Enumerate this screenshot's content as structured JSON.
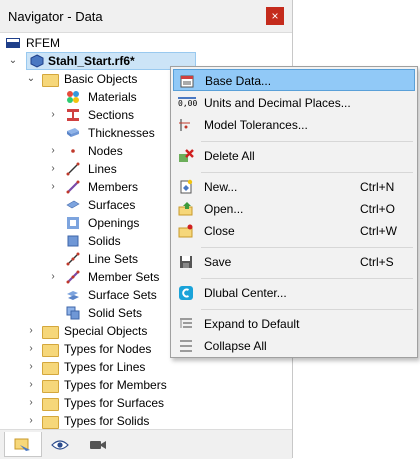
{
  "window": {
    "title": "Navigator - Data",
    "close_glyph": "×"
  },
  "tree": {
    "root": "RFEM",
    "file": "Stahl_Start.rf6*",
    "basic_objects": "Basic Objects",
    "items": [
      {
        "label": "Materials",
        "icon": "materials-icon"
      },
      {
        "label": "Sections",
        "icon": "sections-icon"
      },
      {
        "label": "Thicknesses",
        "icon": "thicknesses-icon"
      },
      {
        "label": "Nodes",
        "icon": "nodes-icon"
      },
      {
        "label": "Lines",
        "icon": "lines-icon"
      },
      {
        "label": "Members",
        "icon": "members-icon"
      },
      {
        "label": "Surfaces",
        "icon": "surfaces-icon"
      },
      {
        "label": "Openings",
        "icon": "openings-icon"
      },
      {
        "label": "Solids",
        "icon": "solids-icon"
      },
      {
        "label": "Line Sets",
        "icon": "line-sets-icon"
      },
      {
        "label": "Member Sets",
        "icon": "member-sets-icon"
      },
      {
        "label": "Surface Sets",
        "icon": "surface-sets-icon"
      },
      {
        "label": "Solid Sets",
        "icon": "solid-sets-icon"
      }
    ],
    "groups": [
      "Special Objects",
      "Types for Nodes",
      "Types for Lines",
      "Types for Members",
      "Types for Surfaces",
      "Types for Solids"
    ]
  },
  "menu": {
    "items": [
      {
        "label": "Base Data...",
        "shortcut": "",
        "icon": "base-data-icon"
      },
      {
        "label": "Units and Decimal Places...",
        "shortcut": "",
        "icon": "units-icon"
      },
      {
        "label": "Model Tolerances...",
        "shortcut": "",
        "icon": "tolerances-icon"
      },
      {
        "label": "Delete All",
        "shortcut": "",
        "icon": "delete-all-icon"
      },
      {
        "label": "New...",
        "shortcut": "Ctrl+N",
        "icon": "new-icon"
      },
      {
        "label": "Open...",
        "shortcut": "Ctrl+O",
        "icon": "open-icon"
      },
      {
        "label": "Close",
        "shortcut": "Ctrl+W",
        "icon": "close-file-icon"
      },
      {
        "label": "Save",
        "shortcut": "Ctrl+S",
        "icon": "save-icon"
      },
      {
        "label": "Dlubal Center...",
        "shortcut": "",
        "icon": "dlubal-center-icon"
      },
      {
        "label": "Expand to Default",
        "shortcut": "",
        "icon": "expand-icon"
      },
      {
        "label": "Collapse All",
        "shortcut": "",
        "icon": "collapse-icon"
      }
    ],
    "units_icon_text": "0,00"
  },
  "colors": {
    "selection": "#cce4f7",
    "menu_highlight": "#91c9f7",
    "close_red": "#c42b1c",
    "folder": "#f6d77a"
  }
}
